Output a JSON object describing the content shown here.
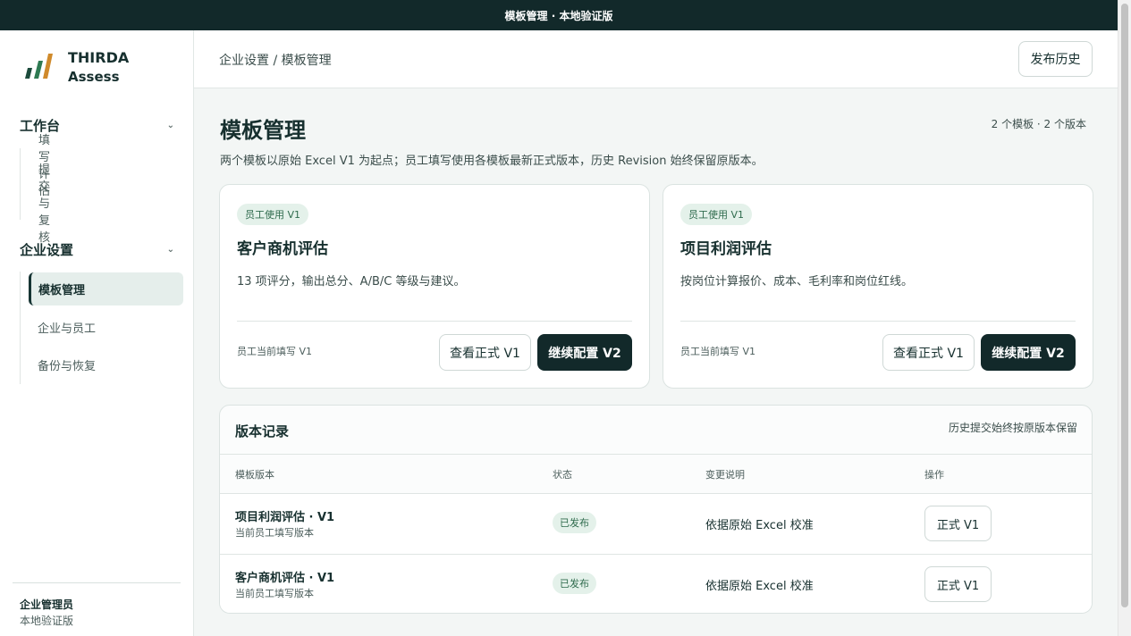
{
  "topbar": {
    "title": "模板管理 · 本地验证版"
  },
  "brand": {
    "line1": "THIRDA",
    "line2": "Assess",
    "colors": [
      "#1c4b3c",
      "#2e7a52",
      "#d08a2b"
    ]
  },
  "sidebar": {
    "sections": [
      {
        "label": "工作台",
        "icon": "chevron-down-icon",
        "items": [
          {
            "label": "填写评估"
          },
          {
            "label": "提交与复核"
          }
        ]
      },
      {
        "label": "企业设置",
        "icon": "chevron-down-icon",
        "items": [
          {
            "label": "模板管理",
            "active": true
          },
          {
            "label": "企业与员工"
          },
          {
            "label": "备份与恢复"
          }
        ]
      }
    ],
    "user": {
      "role": "企业管理员",
      "env": "本地验证版"
    }
  },
  "header": {
    "breadcrumb": "企业设置 / 模板管理",
    "history_button": "发布历史"
  },
  "page": {
    "title": "模板管理",
    "count": "2 个模板 · 2 个版本",
    "description": "两个模板以原始 Excel V1 为起点；员工填写使用各模板最新正式版本，历史 Revision 始终保留原版本。"
  },
  "cards": [
    {
      "badge": "员工使用 V1",
      "title": "客户商机评估",
      "description": "13 项评分，输出总分、A/B/C 等级与建议。",
      "footer": "员工当前填写 V1",
      "view_button": "查看正式 V1",
      "continue_button": "继续配置 V2"
    },
    {
      "badge": "员工使用 V1",
      "title": "项目利润评估",
      "description": "按岗位计算报价、成本、毛利率和岗位红线。",
      "footer": "员工当前填写 V1",
      "view_button": "查看正式 V1",
      "continue_button": "继续配置 V2"
    }
  ],
  "versions": {
    "title": "版本记录",
    "note": "历史提交始终按原版本保留",
    "headers": [
      "模板版本",
      "状态",
      "变更说明",
      "操作"
    ],
    "rows": [
      {
        "name": "项目利润评估 · V1",
        "sub": "当前员工填写版本",
        "status": "已发布",
        "change": "依据原始 Excel 校准",
        "action": "正式 V1"
      },
      {
        "name": "客户商机评估 · V1",
        "sub": "当前员工填写版本",
        "status": "已发布",
        "change": "依据原始 Excel 校准",
        "action": "正式 V1"
      }
    ]
  },
  "colors": {
    "dark": "#12292a",
    "badge_bg": "#e4f1ea",
    "badge_text": "#2f6b4d"
  }
}
